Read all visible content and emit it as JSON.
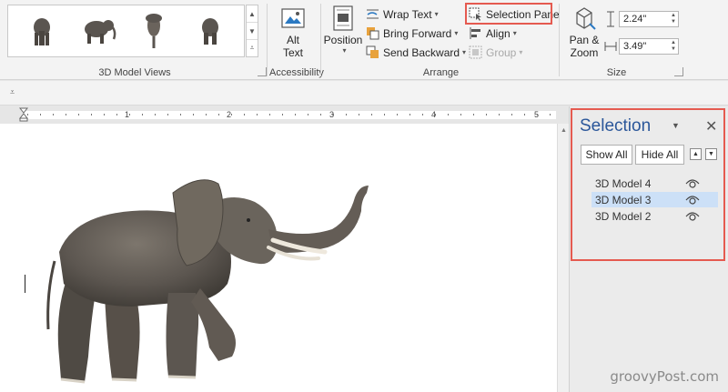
{
  "ribbon": {
    "model_views_label": "3D Model Views",
    "accessibility": {
      "alt_text_label": "Alt\nText",
      "group_label": "Accessibility"
    },
    "arrange": {
      "position_label": "Position",
      "wrap_text_label": "Wrap Text",
      "bring_forward_label": "Bring Forward",
      "send_backward_label": "Send Backward",
      "selection_pane_label": "Selection Pane",
      "align_label": "Align",
      "group_label_btn": "Group",
      "group_label": "Arrange"
    },
    "size": {
      "pan_zoom_label": "Pan &\nZoom",
      "height_value": "2.24\"",
      "width_value": "3.49\"",
      "group_label": "Size"
    }
  },
  "ruler": {
    "numbers": [
      "1",
      "2",
      "3",
      "4",
      "5"
    ]
  },
  "selection_pane": {
    "title": "Selection",
    "show_all": "Show All",
    "hide_all": "Hide All",
    "items": [
      {
        "label": "3D Model 4",
        "selected": false
      },
      {
        "label": "3D Model 3",
        "selected": true
      },
      {
        "label": "3D Model 2",
        "selected": false
      }
    ]
  },
  "watermark": "groovyPost.com",
  "colors": {
    "accent": "#2b579a",
    "highlight": "#e55a50",
    "selection": "#cce0f7"
  }
}
